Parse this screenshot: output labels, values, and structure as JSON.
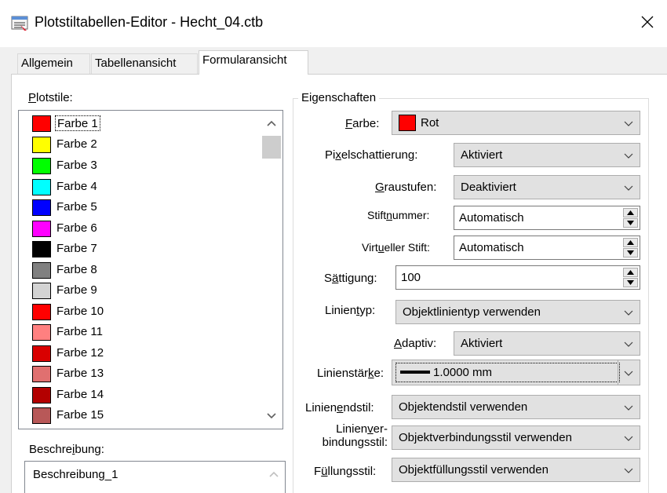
{
  "window": {
    "title": "Plotstiltabellen-Editor - Hecht_04.ctb",
    "close_glyph": "✕"
  },
  "tabs": [
    {
      "label": "Allgemein"
    },
    {
      "label": "Tabellenansicht"
    },
    {
      "label": "Formularansicht",
      "active": true
    }
  ],
  "plotstile": {
    "label_u": "P",
    "label_rest": "lotstile:",
    "items": [
      {
        "label": "Farbe 1",
        "color": "#ff0000",
        "selected": true
      },
      {
        "label": "Farbe 2",
        "color": "#ffff00"
      },
      {
        "label": "Farbe 3",
        "color": "#00ff00"
      },
      {
        "label": "Farbe 4",
        "color": "#00ffff"
      },
      {
        "label": "Farbe 5",
        "color": "#0000ff"
      },
      {
        "label": "Farbe 6",
        "color": "#ff00ff"
      },
      {
        "label": "Farbe 7",
        "color": "#000000"
      },
      {
        "label": "Farbe 8",
        "color": "#808080"
      },
      {
        "label": "Farbe 9",
        "color": "#d3d3d3"
      },
      {
        "label": "Farbe 10",
        "color": "#ff0000"
      },
      {
        "label": "Farbe 11",
        "color": "#ff8080"
      },
      {
        "label": "Farbe 12",
        "color": "#d90000"
      },
      {
        "label": "Farbe 13",
        "color": "#e07070"
      },
      {
        "label": "Farbe 14",
        "color": "#b30000"
      },
      {
        "label": "Farbe 15",
        "color": "#b85858"
      }
    ]
  },
  "beschreibung": {
    "label_pre": "Beschre",
    "label_u": "i",
    "label_post": "bung:",
    "value": "Beschreibung_1"
  },
  "eigenschaften": {
    "title": "Eigenschaften",
    "farbe": {
      "label_u": "F",
      "label_rest": "arbe:",
      "value": "Rot",
      "swatch": "#ff0000"
    },
    "pixel": {
      "label_pre": "Pi",
      "label_u": "x",
      "label_post": "elschattierung:",
      "value": "Aktiviert"
    },
    "grau": {
      "label_u": "G",
      "label_rest": "raustufen:",
      "value": "Deaktiviert"
    },
    "stift": {
      "label_pre": "Stift",
      "label_u": "n",
      "label_post": "ummer:",
      "value": "Automatisch"
    },
    "virtuell": {
      "label_pre": "Virt",
      "label_u": "u",
      "label_post": "eller Stift:",
      "value": "Automatisch"
    },
    "saett": {
      "label_pre": "S",
      "label_u": "ä",
      "label_post": "ttigung:",
      "value": "100"
    },
    "linientyp": {
      "label_pre": "Linien",
      "label_u": "t",
      "label_post": "yp:",
      "value": "Objektlinientyp verwenden"
    },
    "adaptiv": {
      "label_u": "A",
      "label_rest": "daptiv:",
      "value": "Aktiviert"
    },
    "staerke": {
      "label_pre": "Linienstär",
      "label_u": "k",
      "label_post": "e:",
      "value": "1.0000 mm"
    },
    "endstil": {
      "label_pre": "Linien",
      "label_u": "e",
      "label_post": "ndstil:",
      "value": "Objektendstil verwenden"
    },
    "verbind": {
      "line1_pre": "Linien",
      "line1_u": "v",
      "line1_post": "er-",
      "line2": "bindungsstil:",
      "value": "Objektverbindungsstil verwenden"
    },
    "fuell": {
      "label_pre": "F",
      "label_u": "ü",
      "label_post": "llungsstil:",
      "value": "Objektfüllungsstil verwenden"
    }
  }
}
